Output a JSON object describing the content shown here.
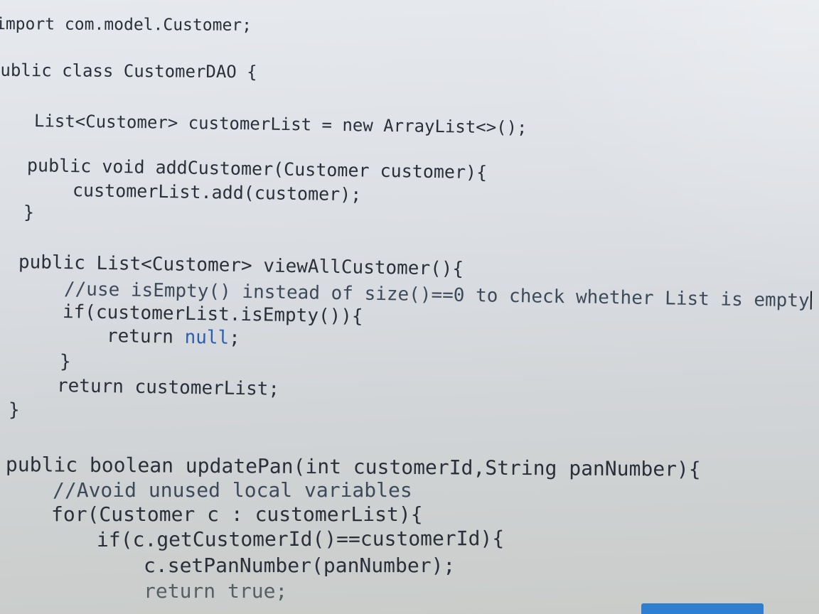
{
  "editor": {
    "lines": [
      "import com.model.Customer;",
      "public class CustomerDAO {",
      "List<Customer> customerList = new ArrayList<>();",
      "public void addCustomer(Customer customer){",
      "customerList.add(customer);",
      "}",
      "public List<Customer> viewAllCustomer(){",
      "//use isEmpty() instead of size()==0 to check whether List is empty",
      "if(customerList.isEmpty()){",
      "return",
      "null",
      ";",
      "}",
      "return customerList;",
      "}",
      "public boolean updatePan(int customerId,String panNumber){",
      "//Avoid unused local variables",
      "for(Customer c : customerList){",
      "if(c.getCustomerId()==customerId){",
      "c.setPanNumber(panNumber);",
      "return true;"
    ]
  },
  "colors": {
    "text": "#2a2f3a",
    "comment": "#3c4a5a",
    "keyword_null": "#2a5fb0",
    "taskbar_accent": "#2f7fd0"
  }
}
